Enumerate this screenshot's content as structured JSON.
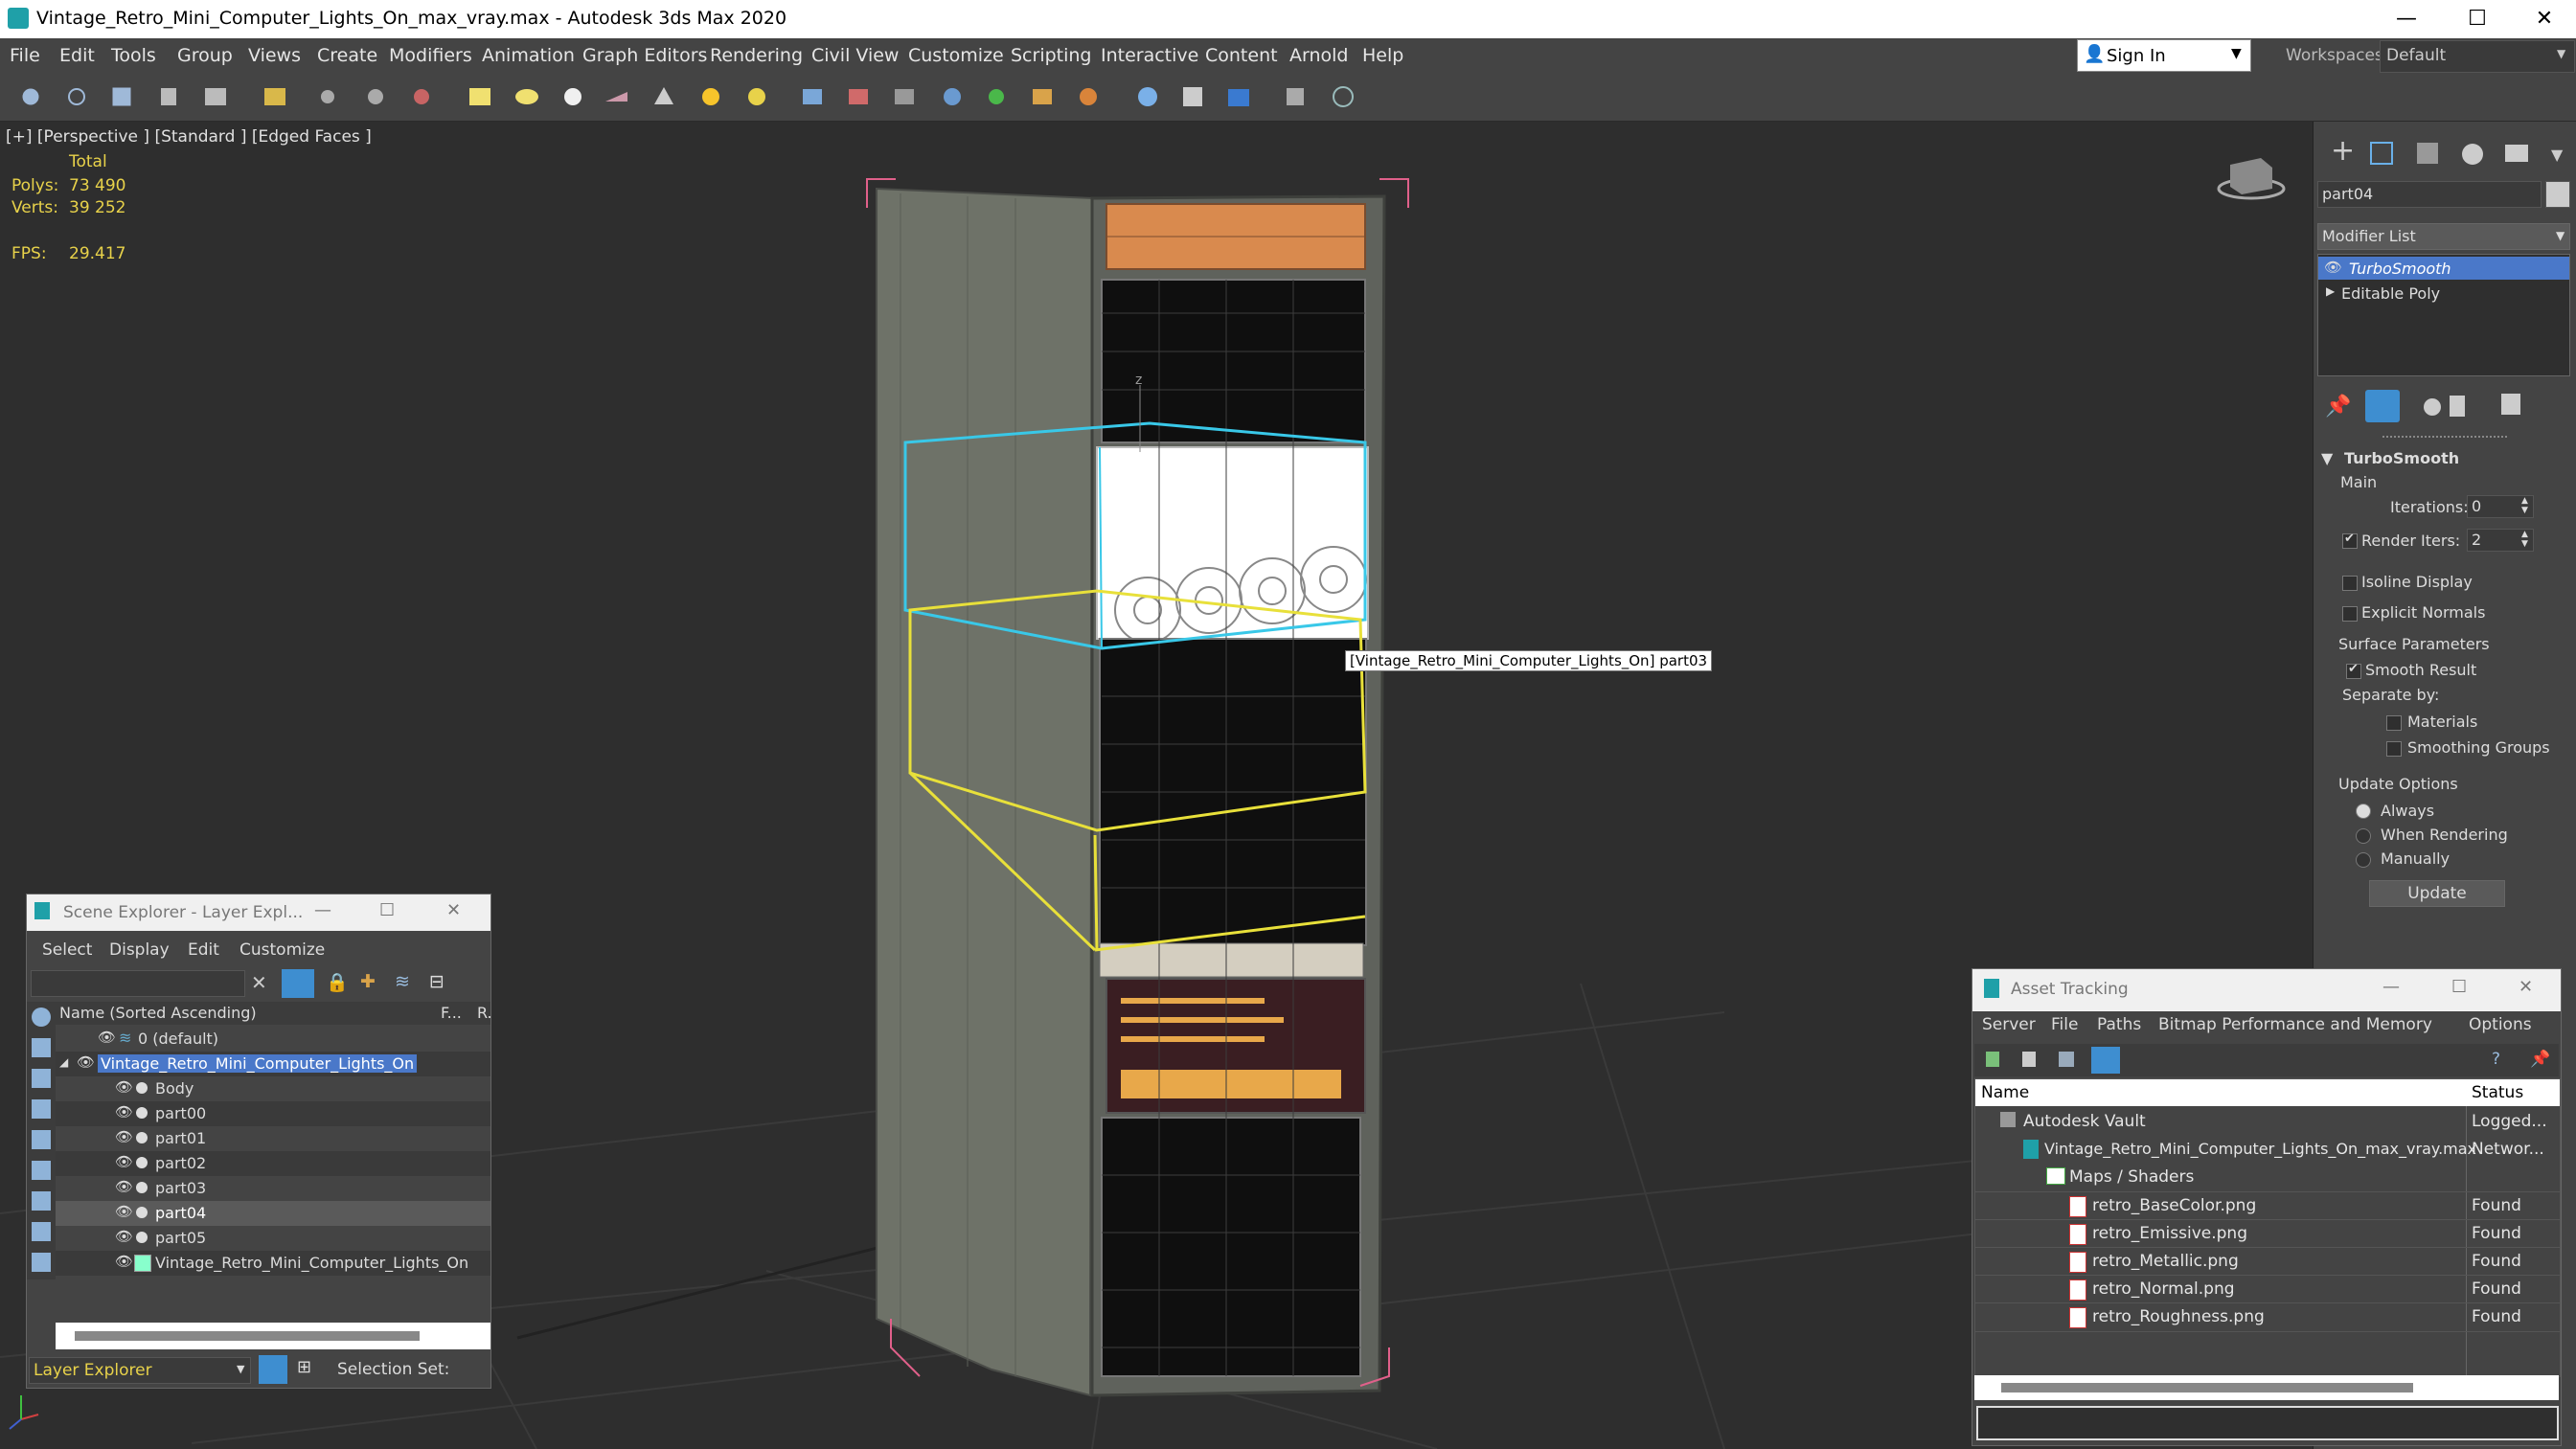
{
  "window": {
    "title": "Vintage_Retro_Mini_Computer_Lights_On_max_vray.max - Autodesk 3ds Max 2020",
    "minimize": "—",
    "maximize": "☐",
    "close": "✕"
  },
  "menu": [
    "File",
    "Edit",
    "Tools",
    "Group",
    "Views",
    "Create",
    "Modifiers",
    "Animation",
    "Graph Editors",
    "Rendering",
    "Civil View",
    "Customize",
    "Scripting",
    "Interactive",
    "Content",
    "Arnold",
    "Help"
  ],
  "signin": {
    "label": "Sign In"
  },
  "workspace": {
    "label": "Workspaces:",
    "value": "Default"
  },
  "viewport": {
    "label": "[+] [Perspective ]  [Standard ]  [Edged Faces ]",
    "stats": {
      "total": "Total",
      "polys_label": "Polys:",
      "polys": "73 490",
      "verts_label": "Verts:",
      "verts": "39 252",
      "fps_label": "FPS:",
      "fps": "29.417"
    },
    "tooltip": "[Vintage_Retro_Mini_Computer_Lights_On] part03",
    "axis_z": "z"
  },
  "command_panel": {
    "object_name": "part04",
    "modifier_list": "Modifier List",
    "stack": [
      "TurboSmooth",
      "Editable Poly"
    ],
    "rollout": "TurboSmooth",
    "main": "Main",
    "iterations_label": "Iterations:",
    "iterations": "0",
    "render_iters_label": "Render Iters:",
    "render_iters": "2",
    "isoline": "Isoline Display",
    "explicit": "Explicit Normals",
    "surface": "Surface Parameters",
    "smooth_result": "Smooth Result",
    "separate_by": "Separate by:",
    "materials": "Materials",
    "smoothing_groups": "Smoothing Groups",
    "update_options": "Update Options",
    "always": "Always",
    "when_rendering": "When Rendering",
    "manually": "Manually",
    "update": "Update"
  },
  "scene_explorer": {
    "title": "Scene Explorer - Layer Expl...",
    "menu": [
      "Select",
      "Display",
      "Edit",
      "Customize"
    ],
    "col_name": "Name (Sorted Ascending)",
    "col_f": "F...",
    "col_r": "R.",
    "rows": [
      {
        "name": "0 (default)",
        "indent": 1
      },
      {
        "name": "Vintage_Retro_Mini_Computer_Lights_On",
        "indent": 0
      },
      {
        "name": "Body",
        "indent": 2
      },
      {
        "name": "part00",
        "indent": 2
      },
      {
        "name": "part01",
        "indent": 2
      },
      {
        "name": "part02",
        "indent": 2
      },
      {
        "name": "part03",
        "indent": 2
      },
      {
        "name": "part04",
        "indent": 2
      },
      {
        "name": "part05",
        "indent": 2
      },
      {
        "name": "Vintage_Retro_Mini_Computer_Lights_On",
        "indent": 2
      }
    ],
    "footer_label": "Layer Explorer",
    "selection_set": "Selection Set:"
  },
  "asset_tracking": {
    "title": "Asset Tracking",
    "menu": [
      "Server",
      "File",
      "Paths",
      "Bitmap Performance and Memory",
      "Options"
    ],
    "col_name": "Name",
    "col_status": "Status",
    "rows": [
      {
        "name": "Autodesk Vault",
        "status": "Logged...",
        "indent": 1
      },
      {
        "name": "Vintage_Retro_Mini_Computer_Lights_On_max_vray.max",
        "status": "Networ...",
        "indent": 2
      },
      {
        "name": "Maps / Shaders",
        "status": "",
        "indent": 3
      },
      {
        "name": "retro_BaseColor.png",
        "status": "Found",
        "indent": 4
      },
      {
        "name": "retro_Emissive.png",
        "status": "Found",
        "indent": 4
      },
      {
        "name": "retro_Metallic.png",
        "status": "Found",
        "indent": 4
      },
      {
        "name": "retro_Normal.png",
        "status": "Found",
        "indent": 4
      },
      {
        "name": "retro_Roughness.png",
        "status": "Found",
        "indent": 4
      }
    ]
  },
  "colors": {
    "selection_blue": "#4a78c9",
    "stats_yellow": "#e8d24a",
    "bbox_cyan": "#39c8e8",
    "bbox_yellow": "#e8e03a"
  }
}
